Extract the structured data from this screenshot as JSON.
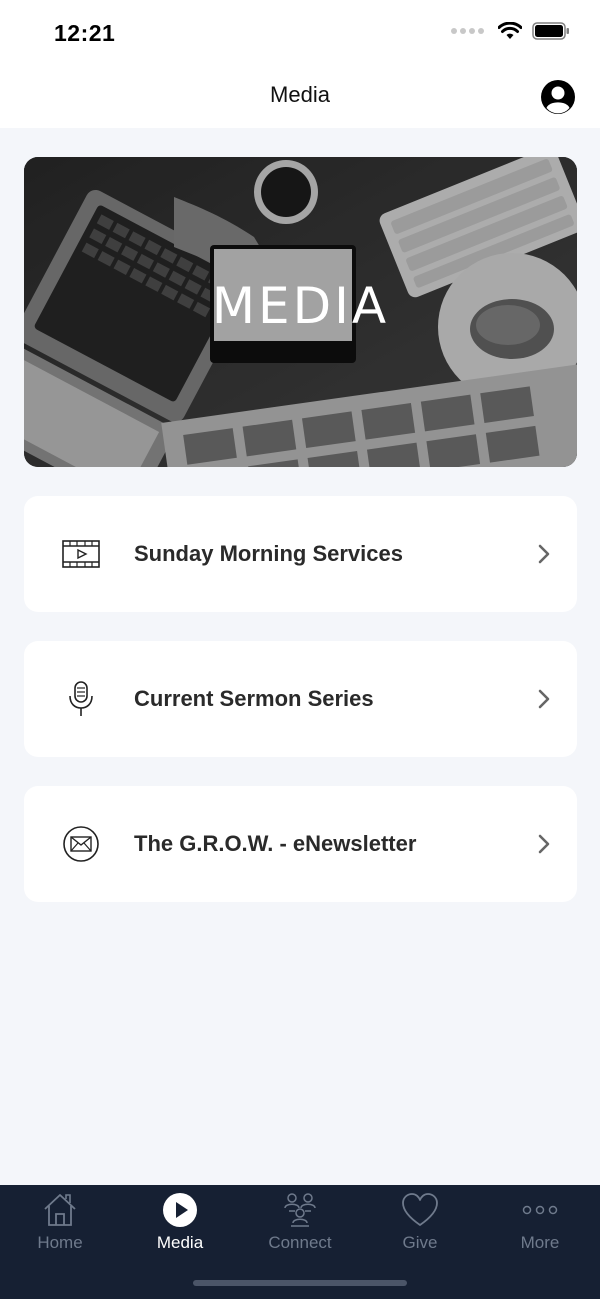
{
  "status_bar": {
    "time": "12:21"
  },
  "nav": {
    "title": "Media"
  },
  "hero": {
    "title": "MEDIA"
  },
  "menu": [
    {
      "label": "Sunday Morning Services",
      "icon": "video-icon"
    },
    {
      "label": "Current Sermon Series",
      "icon": "microphone-icon"
    },
    {
      "label": "The G.R.O.W. - eNewsletter",
      "icon": "envelope-icon"
    }
  ],
  "tabs": [
    {
      "label": "Home",
      "icon": "home-icon",
      "active": false
    },
    {
      "label": "Media",
      "icon": "play-icon",
      "active": true
    },
    {
      "label": "Connect",
      "icon": "people-icon",
      "active": false
    },
    {
      "label": "Give",
      "icon": "heart-icon",
      "active": false
    },
    {
      "label": "More",
      "icon": "more-icon",
      "active": false
    }
  ],
  "colors": {
    "tab_bar_bg": "#162033",
    "tab_active": "#ffffff",
    "tab_inactive": "#6f7a8c",
    "page_bg": "#f4f6fa"
  }
}
